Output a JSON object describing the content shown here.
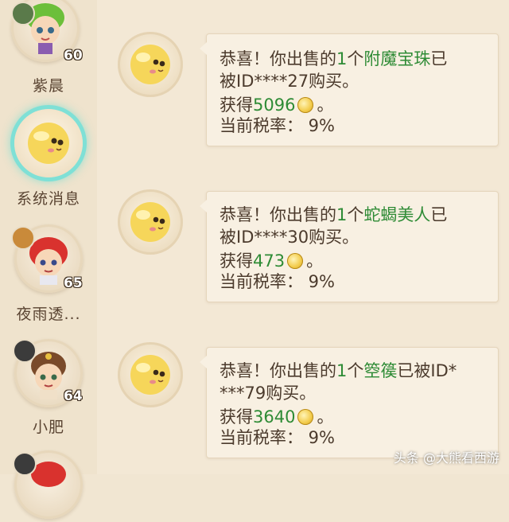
{
  "sidebar": {
    "contacts": [
      {
        "name": "紫晨",
        "level": "60",
        "badge_icon": "lotus-badge-icon"
      },
      {
        "name": "系统消息",
        "level": "",
        "active": true
      },
      {
        "name": "夜雨透...",
        "level": "65",
        "badge_icon": "sword-badge-icon"
      },
      {
        "name": "小肥",
        "level": "64",
        "badge_icon": "book-badge-icon"
      }
    ]
  },
  "messages": [
    {
      "line1_prefix": "恭喜！你出售的",
      "quantity": "1",
      "line1_unit": "个",
      "item": "附魔宝珠",
      "line1_suffix": "已",
      "line2": "被ID****27购买。",
      "gain_label": "获得",
      "gain_value": "5096",
      "gain_suffix": "。",
      "tax": "当前税率： 9%"
    },
    {
      "line1_prefix": "恭喜！你出售的",
      "quantity": "1",
      "line1_unit": "个",
      "item": "蛇蝎美人",
      "line1_suffix": "已",
      "line2": "被ID****30购买。",
      "gain_label": "获得",
      "gain_value": "473",
      "gain_suffix": "。",
      "tax": "当前税率： 9%"
    },
    {
      "line1_prefix": "恭喜！你出售的",
      "quantity": "1",
      "line1_unit": "个",
      "item": "箜篌",
      "line1_suffix": "已被ID*",
      "line2": "***79购买。",
      "gain_label": "获得",
      "gain_value": "3640",
      "gain_suffix": "。",
      "tax": "当前税率： 9%"
    }
  ],
  "watermark": "头条 @大熊看西游",
  "colors": {
    "highlight_green": "#2e8b35",
    "active_glow": "#7fe0d6",
    "text": "#4b3a2c"
  }
}
